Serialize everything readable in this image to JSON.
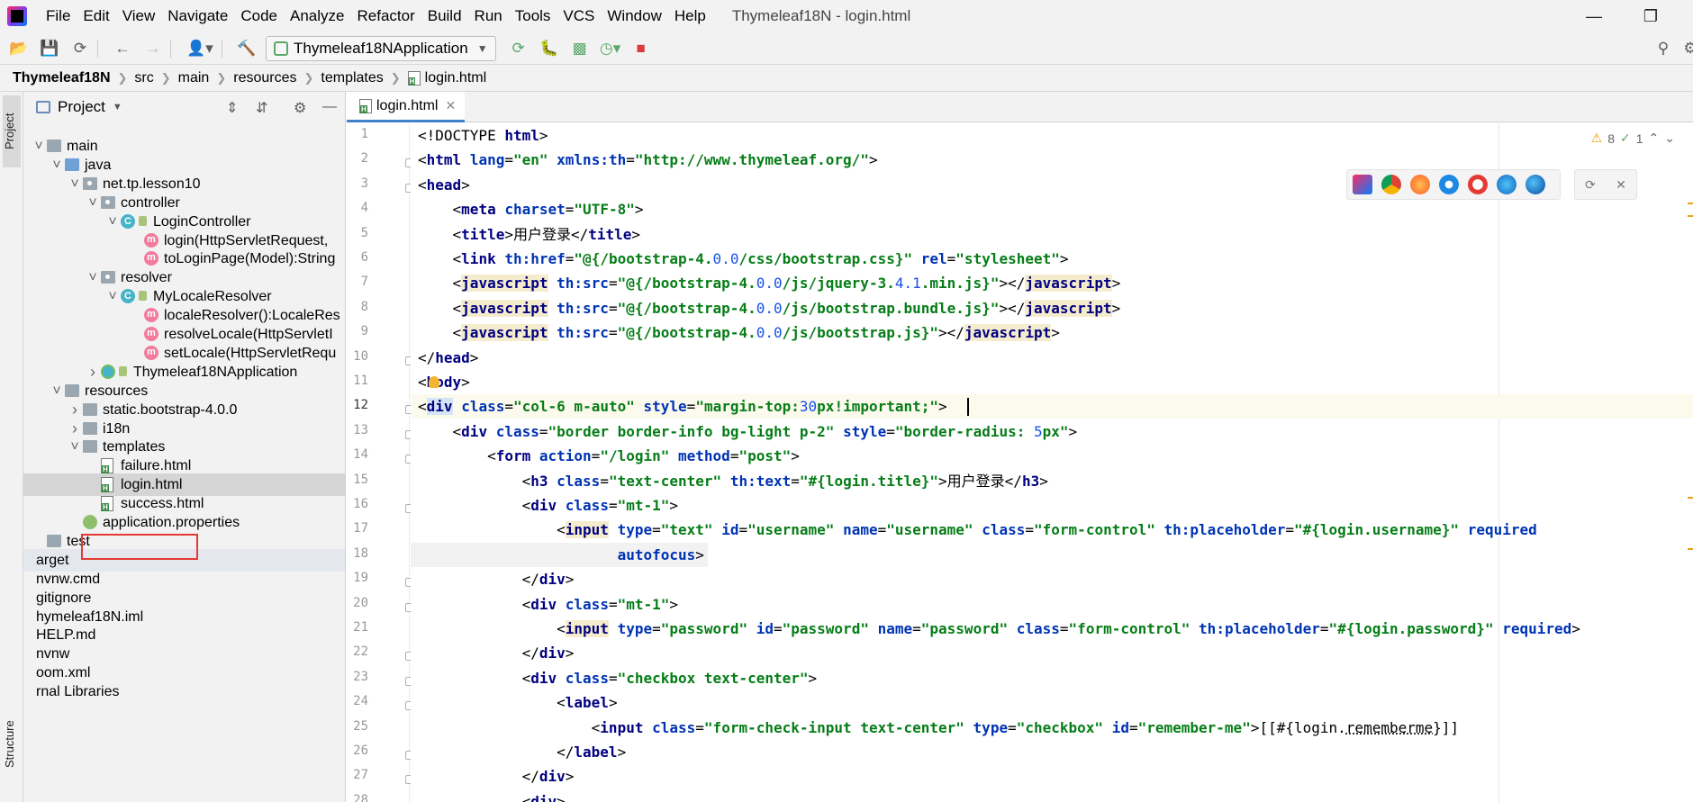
{
  "menubar": {
    "items": [
      "File",
      "Edit",
      "View",
      "Navigate",
      "Code",
      "Analyze",
      "Refactor",
      "Build",
      "Run",
      "Tools",
      "VCS",
      "Window",
      "Help"
    ],
    "window_title": "Thymeleaf18N - login.html"
  },
  "toolbar": {
    "run_config": "Thymeleaf18NApplication"
  },
  "breadcrumb": {
    "items": [
      "Thymeleaf18N",
      "src",
      "main",
      "resources",
      "templates",
      "login.html"
    ]
  },
  "sidebar": {
    "stripe_project": "Project",
    "stripe_structure": "Structure",
    "header_title": "Project",
    "tree": [
      {
        "label": "main",
        "icon": "folder",
        "selected": false
      },
      {
        "label": "java",
        "icon": "source-folder",
        "selected": false
      },
      {
        "label": "net.tp.lesson10",
        "icon": "package",
        "selected": false
      },
      {
        "label": "controller",
        "icon": "package",
        "selected": false
      },
      {
        "label": "LoginController",
        "icon": "class",
        "selected": false
      },
      {
        "label": "login(HttpServletRequest,",
        "icon": "method",
        "selected": false
      },
      {
        "label": "toLoginPage(Model):String",
        "icon": "method",
        "selected": false
      },
      {
        "label": "resolver",
        "icon": "package",
        "selected": false
      },
      {
        "label": "MyLocaleResolver",
        "icon": "class",
        "selected": false
      },
      {
        "label": "localeResolver():LocaleRes",
        "icon": "method",
        "selected": false
      },
      {
        "label": "resolveLocale(HttpServletI",
        "icon": "method",
        "selected": false
      },
      {
        "label": "setLocale(HttpServletRequ",
        "icon": "method",
        "selected": false
      },
      {
        "label": "Thymeleaf18NApplication",
        "icon": "spring-class",
        "selected": false
      },
      {
        "label": "resources",
        "icon": "folder",
        "selected": false
      },
      {
        "label": "static.bootstrap-4.0.0",
        "icon": "folder",
        "selected": false
      },
      {
        "label": "i18n",
        "icon": "folder",
        "selected": false
      },
      {
        "label": "templates",
        "icon": "folder",
        "selected": false
      },
      {
        "label": "failure.html",
        "icon": "html-file",
        "selected": false
      },
      {
        "label": "login.html",
        "icon": "html-file",
        "selected": true
      },
      {
        "label": "success.html",
        "icon": "html-file",
        "selected": false
      },
      {
        "label": "application.properties",
        "icon": "properties-file",
        "selected": false
      },
      {
        "label": "test",
        "icon": "folder",
        "selected": false
      },
      {
        "label": "arget",
        "icon": "none",
        "selected": false
      },
      {
        "label": "nvnw.cmd",
        "icon": "none",
        "selected": false
      },
      {
        "label": "gitignore",
        "icon": "none",
        "selected": false
      },
      {
        "label": "hymeleaf18N.iml",
        "icon": "none",
        "selected": false
      },
      {
        "label": "HELP.md",
        "icon": "none",
        "selected": false
      },
      {
        "label": "nvnw",
        "icon": "none",
        "selected": false
      },
      {
        "label": "oom.xml",
        "icon": "none",
        "selected": false
      },
      {
        "label": "rnal Libraries",
        "icon": "none",
        "selected": false
      }
    ]
  },
  "editor": {
    "tab_label": "login.html",
    "inspection_warnings": "8",
    "inspection_ok": "1",
    "line_numbers": [
      "1",
      "2",
      "3",
      "4",
      "5",
      "6",
      "7",
      "8",
      "9",
      "10",
      "11",
      "12",
      "13",
      "14",
      "15",
      "16",
      "17",
      "18",
      "19",
      "20",
      "21",
      "22",
      "23",
      "24",
      "25",
      "26",
      "27",
      "28"
    ],
    "current_line": "12"
  },
  "colors": {
    "tag": "#000080",
    "attribute": "#0033b3",
    "value": "#067d17",
    "selection_red": "#e53935",
    "accent": "#4083c9"
  }
}
